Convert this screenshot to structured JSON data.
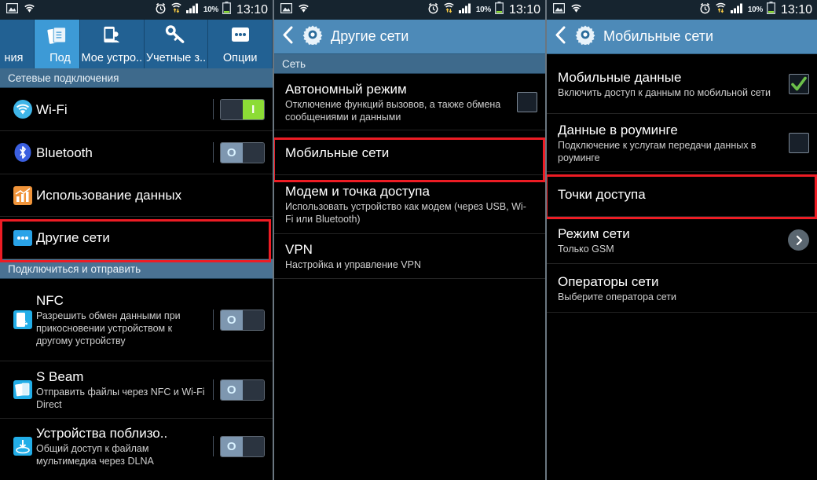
{
  "status_bar": {
    "left_icons": [
      "image-icon",
      "wifi-icon"
    ],
    "alarm_icon": "alarm-clock-icon",
    "data_icon": "wifi-data-transfer-icon",
    "signal_icon": "signal-bars-icon",
    "battery_percent": "10%",
    "battery_icon": "battery-icon",
    "clock": "13:10"
  },
  "panel1": {
    "tabs": [
      {
        "label": "ния",
        "icon": "partial-tab-icon",
        "active": false,
        "partial": true
      },
      {
        "label": "Под",
        "icon": "connections-icon",
        "active": true,
        "partial": true
      },
      {
        "label": "Мое устро..",
        "icon": "my-device-icon",
        "active": false,
        "partial": false
      },
      {
        "label": "Учетные з..",
        "icon": "accounts-key-icon",
        "active": false,
        "partial": false
      },
      {
        "label": "Опции",
        "icon": "more-options-icon",
        "active": false,
        "partial": false
      }
    ],
    "sections": [
      {
        "header": "Сетевые подключения",
        "rows": [
          {
            "icon": "wifi-icon",
            "title": "Wi-Fi",
            "sub": "",
            "control": "toggle-on"
          },
          {
            "icon": "bluetooth-icon",
            "title": "Bluetooth",
            "sub": "",
            "control": "toggle-off"
          },
          {
            "icon": "data-usage-icon",
            "title": "Использование данных",
            "sub": "",
            "control": "none"
          },
          {
            "icon": "other-networks-icon",
            "title": "Другие сети",
            "sub": "",
            "control": "none",
            "highlighted": true
          }
        ]
      },
      {
        "header": "Подключиться и отправить",
        "rows": [
          {
            "icon": "nfc-icon",
            "title": "NFC",
            "sub": "Разрешить обмен данными при прикосновении устройством к другому устройству",
            "control": "toggle-off"
          },
          {
            "icon": "s-beam-icon",
            "title": "S Beam",
            "sub": "Отправить файлы через NFC и Wi-Fi Direct",
            "control": "toggle-off"
          },
          {
            "icon": "nearby-devices-icon",
            "title": "Устройства поблизо..",
            "sub": "Общий доступ к файлам мультимедиа через DLNA",
            "control": "toggle-off"
          }
        ]
      }
    ]
  },
  "panel2": {
    "back_icon": "back-chevron-icon",
    "settings_icon": "gear-icon",
    "title": "Другие сети",
    "section_header": "Сеть",
    "rows": [
      {
        "title": "Автономный режим",
        "sub": "Отключение функций вызовов, а также обмена сообщениями и данными",
        "control": "checkbox-unchecked"
      },
      {
        "title": "Мобильные сети",
        "sub": "",
        "control": "none",
        "highlighted": true
      },
      {
        "title": "Модем и точка доступа",
        "sub": "Использовать устройство как модем (через USB, Wi-Fi или Bluetooth)",
        "control": "none"
      },
      {
        "title": "VPN",
        "sub": "Настройка и управление VPN",
        "control": "none"
      }
    ]
  },
  "panel3": {
    "back_icon": "back-chevron-icon",
    "settings_icon": "gear-icon",
    "title": "Мобильные сети",
    "rows": [
      {
        "title": "Мобильные данные",
        "sub": "Включить доступ к данным по мобильной сети",
        "control": "checkbox-checked"
      },
      {
        "title": "Данные в роуминге",
        "sub": "Подключение к услугам передачи данных в роуминге",
        "control": "checkbox-unchecked"
      },
      {
        "title": "Точки доступа",
        "sub": "",
        "control": "none",
        "highlighted": true
      },
      {
        "title": "Режим сети",
        "sub": "Только GSM",
        "control": "chevron"
      },
      {
        "title": "Операторы сети",
        "sub": "Выберите оператора сети",
        "control": "none"
      }
    ]
  },
  "colors": {
    "accent_blue": "#3d9ad6",
    "action_bar": "#4d8ab8",
    "highlight_red": "#ed1c24",
    "toggle_on_green": "#8cdc36",
    "check_green": "#6cc04a"
  }
}
